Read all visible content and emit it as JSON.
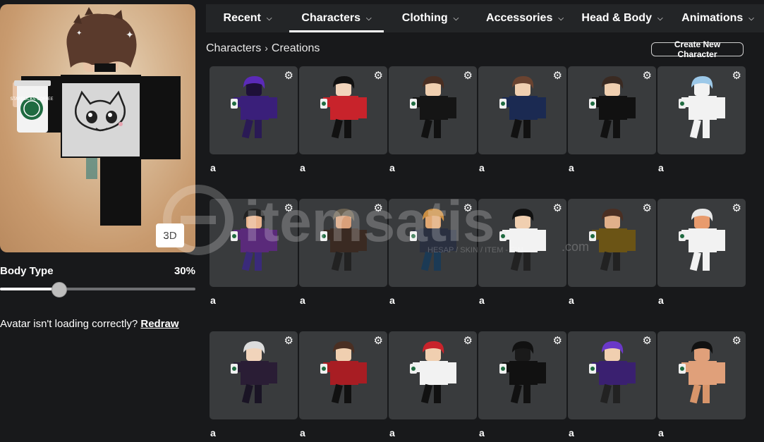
{
  "tabs": [
    {
      "label": "Recent"
    },
    {
      "label": "Characters"
    },
    {
      "label": "Clothing"
    },
    {
      "label": "Accessories"
    },
    {
      "label": "Head & Body"
    },
    {
      "label": "Animations"
    }
  ],
  "breadcrumb": {
    "parent": "Characters",
    "current": "Creations"
  },
  "create_button": "Create New Character",
  "avatar": {
    "view_toggle": "3D",
    "cup_text": "STARBUCKS COFFEE"
  },
  "body_type": {
    "label": "Body Type",
    "value_text": "30%",
    "value": 0.3
  },
  "redraw": {
    "message": "Avatar isn't loading correctly?",
    "link": "Redraw"
  },
  "watermark": {
    "text": "itemsatis",
    "sub": "HESAP / SKIN / ITEM - PIN",
    "dotcom": ".com"
  },
  "characters": [
    {
      "name": "a",
      "shirt": "#3a1f7a",
      "pants": "#2a1a55",
      "hair": "#5b2ab8",
      "skin": "#1e1038"
    },
    {
      "name": "a",
      "shirt": "#c8232b",
      "pants": "#111111",
      "hair": "#111111",
      "skin": "#f1d4bb"
    },
    {
      "name": "a",
      "shirt": "#151515",
      "pants": "#111111",
      "hair": "#4a2f23",
      "skin": "#f0cfb0"
    },
    {
      "name": "a",
      "shirt": "#1b2a52",
      "pants": "#111111",
      "hair": "#6a4330",
      "skin": "#f0cfb0"
    },
    {
      "name": "a",
      "shirt": "#111111",
      "pants": "#111111",
      "hair": "#3a2a22",
      "skin": "#f0cfb0"
    },
    {
      "name": "a",
      "shirt": "#f2f2f2",
      "pants": "#f2f2f2",
      "hair": "#9cc8e8",
      "skin": "#f2f2f2"
    },
    {
      "name": "a",
      "shirt": "#5a2a7a",
      "pants": "#3a2a7a",
      "hair": "#222222",
      "skin": "#e9b48d"
    },
    {
      "name": "a",
      "shirt": "#3a2a22",
      "pants": "#222222",
      "hair": "#6b6252",
      "skin": "#d9a07a"
    },
    {
      "name": "a",
      "shirt": "#2a3040",
      "pants": "#1b3a55",
      "hair": "#c98d42",
      "skin": "#e0a772"
    },
    {
      "name": "a",
      "shirt": "#f2f2f2",
      "pants": "#222222",
      "hair": "#111111",
      "skin": "#f0cfb0"
    },
    {
      "name": "a",
      "shirt": "#6b5415",
      "pants": "#222222",
      "hair": "#4a2f23",
      "skin": "#e0b08a"
    },
    {
      "name": "a",
      "shirt": "#f2f2f2",
      "pants": "#f2f2f2",
      "hair": "#e8e8e8",
      "skin": "#e89b6d"
    },
    {
      "name": "a",
      "shirt": "#2a1d35",
      "pants": "#1a1425",
      "hair": "#dcdcdc",
      "skin": "#f1d4bb"
    },
    {
      "name": "a",
      "shirt": "#a81d23",
      "pants": "#111111",
      "hair": "#4a2f23",
      "skin": "#f0cfb0"
    },
    {
      "name": "a",
      "shirt": "#f2f2f2",
      "pants": "#111111",
      "hair": "#c8232b",
      "skin": "#f0cfb0"
    },
    {
      "name": "a",
      "shirt": "#111111",
      "pants": "#111111",
      "hair": "#111111",
      "skin": "#1a1a1a"
    },
    {
      "name": "a",
      "shirt": "#3a2070",
      "pants": "#222222",
      "hair": "#6a38c8",
      "skin": "#f0cfb0"
    },
    {
      "name": "a",
      "shirt": "#e0a07a",
      "pants": "#d8956a",
      "hair": "#111111",
      "skin": "#e0a07a"
    }
  ]
}
